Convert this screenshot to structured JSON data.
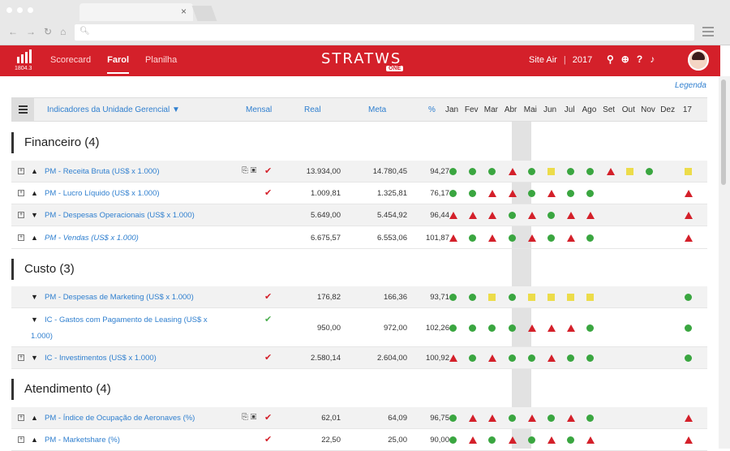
{
  "browser": {
    "tab_close": "×"
  },
  "app": {
    "logo_version": "1804.3",
    "nav": [
      "Scorecard",
      "Farol",
      "Planilha"
    ],
    "brand": "STRATWS",
    "brand_sub": "ONE",
    "site": "Site Air",
    "year": "2017"
  },
  "legend_link": "Legenda",
  "table": {
    "unit_selector": "Indicadores da Unidade Gerencial",
    "col_mensal": "Mensal",
    "col_real": "Real",
    "col_meta": "Meta",
    "col_pct": "%",
    "months": [
      "Jan",
      "Fev",
      "Mar",
      "Abr",
      "Mai",
      "Jun",
      "Jul",
      "Ago",
      "Set",
      "Out",
      "Nov",
      "Dez",
      "17"
    ]
  },
  "sections": [
    {
      "title": "Financeiro (4)",
      "rows": [
        {
          "name": "PM - Receita Bruta (US$ x 1.000)",
          "trend": "▲",
          "plus": true,
          "flags": true,
          "check": "red",
          "real": "13.934,00",
          "meta": "14.780,45",
          "pct": "94,27",
          "status": [
            "g",
            "g",
            "g",
            "r",
            "g",
            "y",
            "g",
            "g",
            "r",
            "y",
            "g",
            "",
            "y"
          ]
        },
        {
          "name": "PM - Lucro Líquido (US$ x 1.000)",
          "trend": "▲",
          "plus": true,
          "flags": false,
          "check": "red",
          "real": "1.009,81",
          "meta": "1.325,81",
          "pct": "76,17",
          "status": [
            "g",
            "g",
            "r",
            "r",
            "g",
            "r",
            "g",
            "g",
            "",
            "",
            "",
            "",
            "r"
          ]
        },
        {
          "name": "PM - Despesas Operacionais (US$ x 1.000)",
          "trend": "▼",
          "plus": true,
          "flags": false,
          "check": "",
          "real": "5.649,00",
          "meta": "5.454,92",
          "pct": "96,44",
          "status": [
            "r",
            "r",
            "r",
            "g",
            "r",
            "g",
            "r",
            "r",
            "",
            "",
            "",
            "",
            "r"
          ]
        },
        {
          "name": "PM - Vendas (US$ x 1.000)",
          "trend": "▲",
          "plus": true,
          "flags": false,
          "check": "",
          "italic": true,
          "real": "6.675,57",
          "meta": "6.553,06",
          "pct": "101,87",
          "status": [
            "r",
            "g",
            "r",
            "g",
            "r",
            "g",
            "r",
            "g",
            "",
            "",
            "",
            "",
            "r"
          ]
        }
      ]
    },
    {
      "title": "Custo (3)",
      "rows": [
        {
          "name": "PM - Despesas de Marketing (US$ x 1.000)",
          "trend": "▼",
          "plus": false,
          "flags": false,
          "check": "red",
          "real": "176,82",
          "meta": "166,36",
          "pct": "93,71",
          "status": [
            "g",
            "g",
            "y",
            "g",
            "y",
            "y",
            "y",
            "y",
            "",
            "",
            "",
            "",
            "g"
          ]
        },
        {
          "name": "IC - Gastos com Pagamento de Leasing (US$ x",
          "name2": "1.000)",
          "trend": "▼",
          "plus": false,
          "flags": false,
          "check": "green",
          "real": "950,00",
          "meta": "972,00",
          "pct": "102,26",
          "status": [
            "g",
            "g",
            "g",
            "g",
            "r",
            "r",
            "r",
            "g",
            "",
            "",
            "",
            "",
            "g"
          ]
        },
        {
          "name": "IC - Investimentos (US$ x 1.000)",
          "trend": "▼",
          "plus": true,
          "flags": false,
          "check": "red",
          "real": "2.580,14",
          "meta": "2.604,00",
          "pct": "100,92",
          "status": [
            "r",
            "g",
            "r",
            "g",
            "g",
            "r",
            "g",
            "g",
            "",
            "",
            "",
            "",
            "g"
          ]
        }
      ]
    },
    {
      "title": "Atendimento (4)",
      "rows": [
        {
          "name": "PM - Índice de Ocupação de Aeronaves (%)",
          "trend": "▲",
          "plus": true,
          "flags": true,
          "check": "red",
          "real": "62,01",
          "meta": "64,09",
          "pct": "96,75",
          "status": [
            "g",
            "r",
            "r",
            "g",
            "r",
            "g",
            "r",
            "g",
            "",
            "",
            "",
            "",
            "r"
          ]
        },
        {
          "name": "PM - Marketshare (%)",
          "trend": "▲",
          "plus": true,
          "flags": false,
          "check": "red",
          "real": "22,50",
          "meta": "25,00",
          "pct": "90,00",
          "status": [
            "g",
            "r",
            "g",
            "r",
            "g",
            "r",
            "g",
            "r",
            "",
            "",
            "",
            "",
            "r"
          ]
        }
      ]
    }
  ]
}
